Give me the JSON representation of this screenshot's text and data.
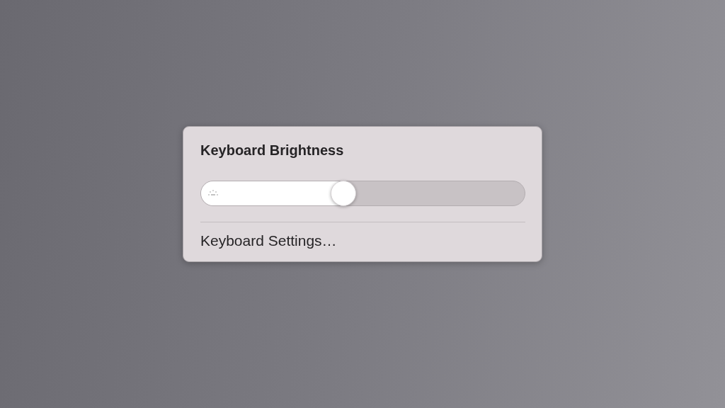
{
  "panel": {
    "title": "Keyboard Brightness",
    "slider": {
      "level": 0.44
    },
    "menu_item": "Keyboard Settings…"
  }
}
